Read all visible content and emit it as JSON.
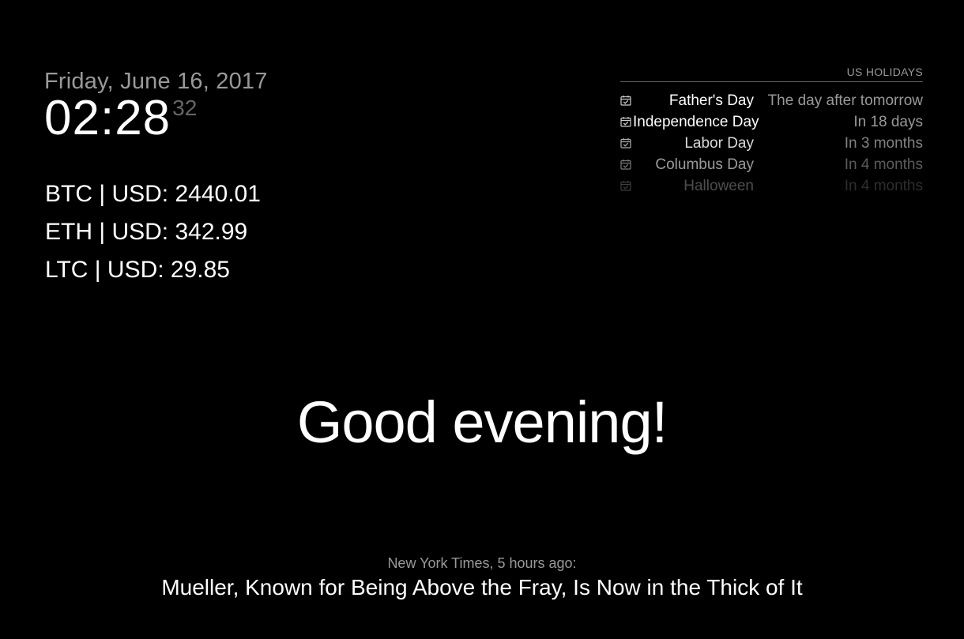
{
  "clock": {
    "date": "Friday, June 16, 2017",
    "time": "02:28",
    "seconds": "32"
  },
  "crypto": {
    "rows": [
      "BTC | USD: 2440.01",
      "ETH | USD: 342.99",
      "LTC | USD: 29.85"
    ]
  },
  "holidays": {
    "header": "US HOLIDAYS",
    "icon": "calendar-check-icon",
    "events": [
      {
        "name": "Father's Day",
        "when": "The day after tomorrow",
        "opacity": 1.0
      },
      {
        "name": "Independence Day",
        "when": "In 18 days",
        "opacity": 1.0
      },
      {
        "name": "Labor Day",
        "when": "In 3 months",
        "opacity": 0.85
      },
      {
        "name": "Columbus Day",
        "when": "In 4 months",
        "opacity": 0.6
      },
      {
        "name": "Halloween",
        "when": "In 4 months",
        "opacity": 0.3
      }
    ]
  },
  "compliment": {
    "text": "Good evening!"
  },
  "news": {
    "source": "New York Times, 5 hours ago:",
    "headline": "Mueller, Known for Being Above the Fray, Is Now in the Thick of It"
  },
  "colors": {
    "background": "#000000",
    "bright": "#ffffff",
    "dimmed": "#999999",
    "muted": "#666666"
  }
}
